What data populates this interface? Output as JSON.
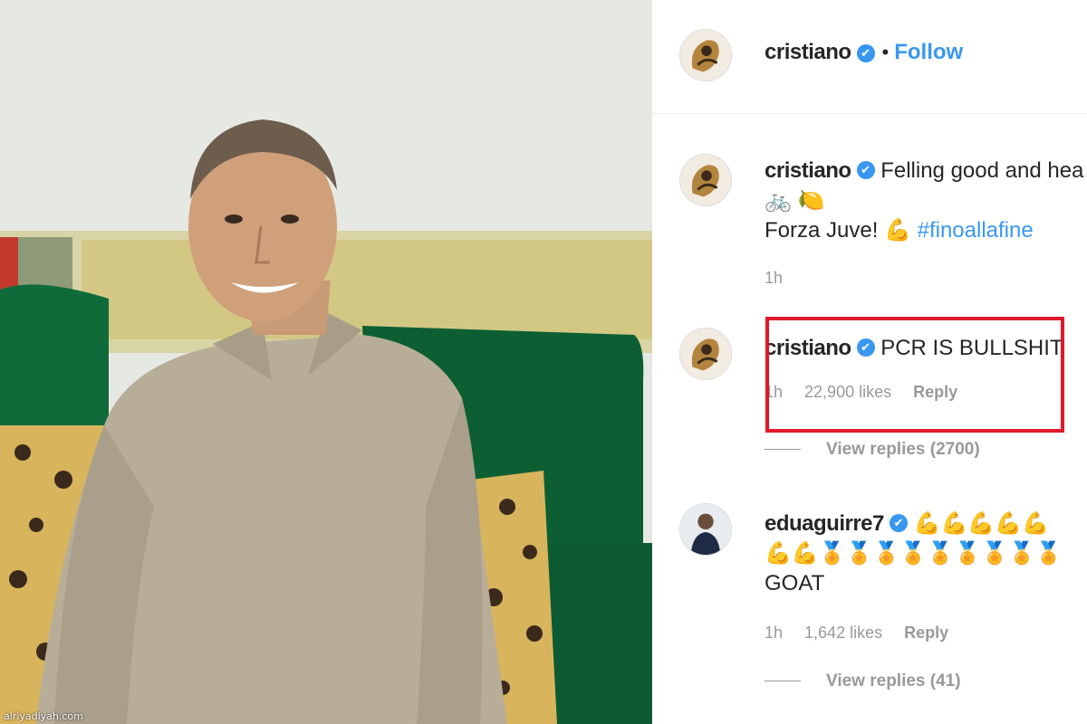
{
  "watermark": "alriyadiyah.com",
  "post": {
    "author": "cristiano",
    "follow_label": "Follow",
    "separator": "•",
    "verified_glyph": "✔"
  },
  "comments": [
    {
      "username": "cristiano",
      "line1": "Felling good and hea",
      "line2_emoji": "🚲 🍋",
      "line3_text": "Forza Juve! 💪",
      "hashtag": "#finoallafine",
      "time": "1h"
    },
    {
      "username": "cristiano",
      "text": "PCR IS BULLSHIT",
      "time": "1h",
      "likes": "22,900 likes",
      "reply": "Reply",
      "view_replies": "View replies (2700)"
    },
    {
      "username": "eduaguirre7",
      "line1_emoji": "💪💪💪💪💪",
      "line2_emoji": "💪💪🏅🏅🏅🏅🏅🏅🏅🏅🏅",
      "line3_text": "GOAT",
      "time": "1h",
      "likes": "1,642 likes",
      "reply": "Reply",
      "view_replies": "View replies (41)"
    }
  ],
  "colors": {
    "accent": "#3897f0",
    "highlight_box": "#e0192b",
    "sofa_green": "#0f6b3a",
    "shirt": "#b8ae98"
  },
  "icons": [
    "verified-badge-icon",
    "avatar-cristiano",
    "avatar-eduaguirre7"
  ]
}
